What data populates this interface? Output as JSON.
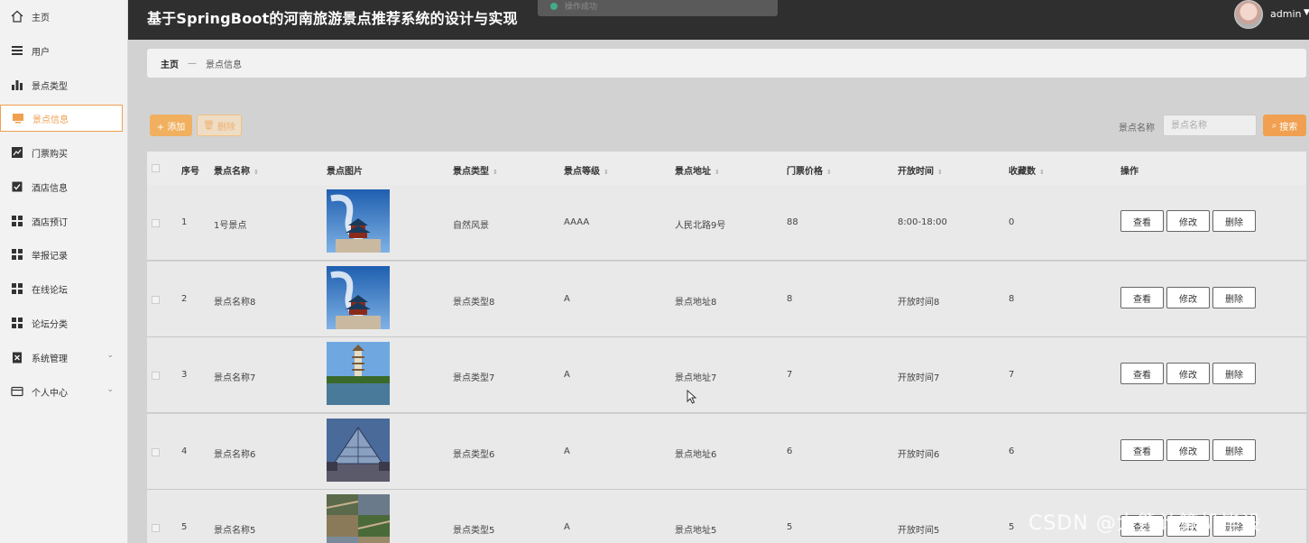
{
  "app_title": "基于SpringBoot的河南旅游景点推荐系统的设计与实现",
  "toast": "操作成功",
  "user": {
    "name": "admin"
  },
  "sidebar": {
    "items": [
      {
        "label": "主页",
        "icon": "home-icon"
      },
      {
        "label": "用户",
        "icon": "list-icon"
      },
      {
        "label": "景点类型",
        "icon": "bar-chart-icon"
      },
      {
        "label": "景点信息",
        "icon": "monitor-icon",
        "active": true
      },
      {
        "label": "门票购买",
        "icon": "line-chart-icon"
      },
      {
        "label": "酒店信息",
        "icon": "checkbox-icon"
      },
      {
        "label": "酒店预订",
        "icon": "grid-icon"
      },
      {
        "label": "举报记录",
        "icon": "grid-icon"
      },
      {
        "label": "在线论坛",
        "icon": "grid-icon"
      },
      {
        "label": "论坛分类",
        "icon": "grid-icon"
      },
      {
        "label": "系统管理",
        "icon": "clipboard-x-icon",
        "expandable": true
      },
      {
        "label": "个人中心",
        "icon": "card-icon",
        "expandable": true
      }
    ]
  },
  "breadcrumb": {
    "home": "主页",
    "separator": "—",
    "current": "景点信息"
  },
  "toolbar": {
    "add_label": "+ 添加",
    "delete_label": "删除",
    "search_label": "景点名称",
    "search_placeholder": "景点名称",
    "search_button": "搜索"
  },
  "colors": {
    "accent": "#f0a050",
    "header": "#2f2f2f",
    "sidebar": "#f2f2f2"
  },
  "table": {
    "columns": [
      "序号",
      "景点名称",
      "景点图片",
      "景点类型",
      "景点等级",
      "景点地址",
      "门票价格",
      "开放时间",
      "收藏数",
      "操作"
    ],
    "rows": [
      {
        "index": "1",
        "name": "1号景点",
        "image": "temple",
        "type": "自然风景",
        "level": "AAAA",
        "address": "人民北路9号",
        "price": "88",
        "hours": "8:00-18:00",
        "favorites": "0"
      },
      {
        "index": "2",
        "name": "景点名称8",
        "image": "temple",
        "type": "景点类型8",
        "level": "A",
        "address": "景点地址8",
        "price": "8",
        "hours": "开放时间8",
        "favorites": "8"
      },
      {
        "index": "3",
        "name": "景点名称7",
        "image": "pagoda",
        "type": "景点类型7",
        "level": "A",
        "address": "景点地址7",
        "price": "7",
        "hours": "开放时间7",
        "favorites": "7"
      },
      {
        "index": "4",
        "name": "景点名称6",
        "image": "pyramid",
        "type": "景点类型6",
        "level": "A",
        "address": "景点地址6",
        "price": "6",
        "hours": "开放时间6",
        "favorites": "6"
      },
      {
        "index": "5",
        "name": "景点名称5",
        "image": "wall",
        "type": "景点类型5",
        "level": "A",
        "address": "景点地址5",
        "price": "5",
        "hours": "开放时间5",
        "favorites": "5"
      }
    ],
    "actions": {
      "view": "查看",
      "edit": "修改",
      "delete": "删除"
    }
  },
  "watermark": "CSDN @大熊计算机毕设"
}
